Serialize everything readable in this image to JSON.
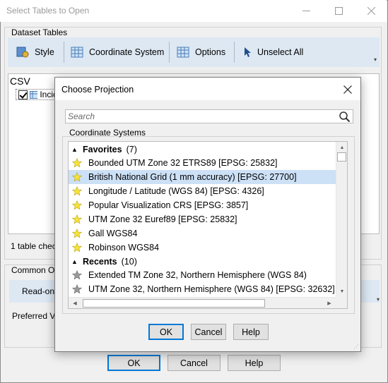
{
  "outer_window": {
    "title": "Select Tables to Open",
    "dataset_group_label": "Dataset Tables",
    "toolbar": {
      "style_label": "Style",
      "coordinate_system_label": "Coordinate System",
      "options_label": "Options",
      "unselect_all_label": "Unselect All"
    },
    "csv_label": "CSV",
    "csv_item_partial": "Incic",
    "checked_count": "1 table chec",
    "common_group_label": "Common O",
    "read_only_label": "Read-onl",
    "preferred_label": "Preferred V",
    "buttons": {
      "ok": "OK",
      "cancel": "Cancel",
      "help": "Help"
    }
  },
  "dialog": {
    "title": "Choose Projection",
    "search": {
      "placeholder": "Search",
      "value": ""
    },
    "coord_group_label": "Coordinate Systems",
    "favorites": {
      "label": "Favorites",
      "count": "(7)",
      "items": [
        "Bounded UTM Zone 32 ETRS89 [EPSG: 25832]",
        "British National Grid (1 mm accuracy) [EPSG: 27700]",
        "Longitude / Latitude (WGS 84) [EPSG: 4326]",
        "Popular Visualization CRS [EPSG: 3857]",
        "UTM Zone 32 Euref89 [EPSG: 25832]",
        "Gall WGS84",
        "Robinson WGS84"
      ],
      "selected_index": 1
    },
    "recents": {
      "label": "Recents",
      "count": "(10)",
      "items": [
        "Extended TM Zone 32, Northern Hemisphere (WGS 84)",
        "UTM Zone 32, Northern Hemisphere (WGS 84) [EPSG: 32632]"
      ]
    },
    "buttons": {
      "ok": "OK",
      "cancel": "Cancel",
      "help": "Help"
    }
  },
  "colors": {
    "favorite_star": "#f5e23c",
    "recent_star": "#9a9a9a",
    "selection": "#cce0f6",
    "default_button_border": "#0078d7",
    "toolbar_bg": "#dde8f3"
  },
  "icons": {
    "style": "style-icon",
    "coordinate_system": "table-grid-icon",
    "options": "table-grid-icon",
    "unselect_all": "cursor-arrow-icon",
    "search": "magnifier-icon",
    "favorite": "star-icon",
    "close": "close-icon"
  }
}
